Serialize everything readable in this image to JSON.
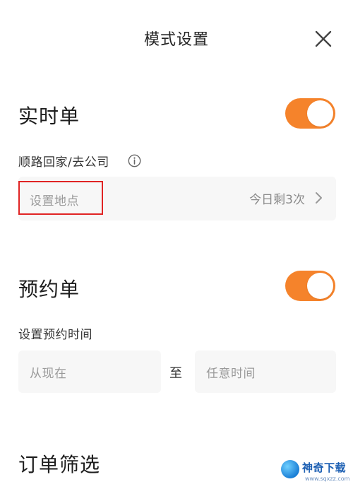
{
  "header": {
    "title": "模式设置"
  },
  "realtime": {
    "title": "实时单",
    "toggle_on": true,
    "commute_label": "顺路回家/去公司",
    "location_placeholder": "设置地点",
    "remaining": "今日剩3次"
  },
  "reservation": {
    "title": "预约单",
    "toggle_on": true,
    "time_label": "设置预约时间",
    "start_placeholder": "从现在",
    "separator": "至",
    "end_placeholder": "任意时间"
  },
  "filter": {
    "title": "订单筛选"
  },
  "watermark": {
    "name": "神奇下载",
    "url": "www.sqxzz.com"
  },
  "colors": {
    "accent": "#f5832b",
    "highlight_border": "#e02424",
    "field_bg": "#f7f7f7"
  },
  "icons": [
    "close-icon",
    "info-icon",
    "chevron-right-icon",
    "logo-icon"
  ]
}
